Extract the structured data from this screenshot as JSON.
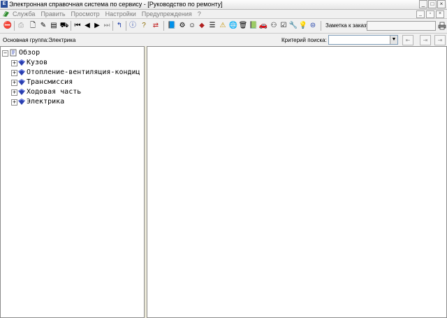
{
  "window": {
    "title": "Электронная справочная система по сервису - [Руководство по ремонту]",
    "minimize": "_",
    "maximize": "□",
    "close": "×"
  },
  "menu": {
    "items": [
      "Служба",
      "Править",
      "Просмотр",
      "Настройки",
      "Предупреждения",
      "?"
    ],
    "mdi_minimize": "_",
    "mdi_restore": "▫",
    "mdi_close": "×"
  },
  "toolbar": {
    "order_note_label": "Заметка к заказу:",
    "order_note_value": ""
  },
  "infobar": {
    "group_label": "Основная группа:Электрика",
    "search_criteria_label": "Критерий поиска:",
    "search_criteria_value": "",
    "search_arrow": "▼"
  },
  "tree": {
    "root": "Обзор",
    "root_expander": "−",
    "items": [
      {
        "label": "Кузов",
        "expander": "+"
      },
      {
        "label": "Отопление-вентиляция-кондиц",
        "expander": "+"
      },
      {
        "label": "Трансмиссия",
        "expander": "+"
      },
      {
        "label": "Ходовая часть",
        "expander": "+"
      },
      {
        "label": "Электрика",
        "expander": "+"
      }
    ]
  },
  "colors": {
    "book_blue": "#2a3fb0",
    "disabled_text": "#7a7a7a",
    "pane_border": "#8a8a8a"
  }
}
